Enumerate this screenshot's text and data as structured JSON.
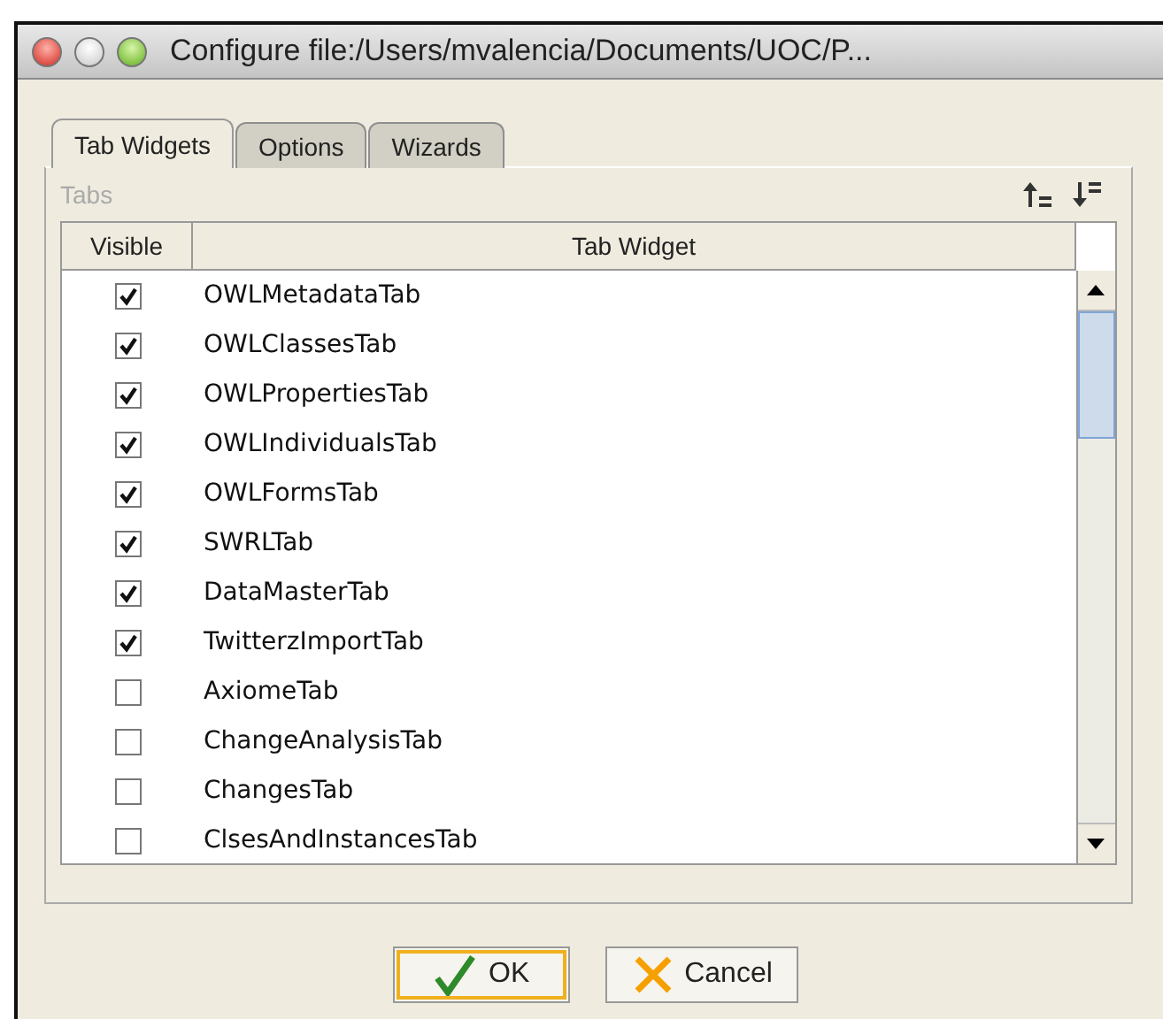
{
  "window": {
    "title": "Configure file:/Users/mvalencia/Documents/UOC/P..."
  },
  "tabs": [
    {
      "label": "Tab Widgets",
      "selected": true
    },
    {
      "label": "Options",
      "selected": false
    },
    {
      "label": "Wizards",
      "selected": false
    }
  ],
  "section": {
    "label": "Tabs"
  },
  "table": {
    "columns": [
      "Visible",
      "Tab Widget"
    ],
    "rows": [
      {
        "name": "OWLMetadataTab",
        "checked": true
      },
      {
        "name": "OWLClassesTab",
        "checked": true
      },
      {
        "name": "OWLPropertiesTab",
        "checked": true
      },
      {
        "name": "OWLIndividualsTab",
        "checked": true
      },
      {
        "name": "OWLFormsTab",
        "checked": true
      },
      {
        "name": "SWRLTab",
        "checked": true
      },
      {
        "name": "DataMasterTab",
        "checked": true
      },
      {
        "name": "TwitterzImportTab",
        "checked": true
      },
      {
        "name": "AxiomeTab",
        "checked": false
      },
      {
        "name": "ChangeAnalysisTab",
        "checked": false
      },
      {
        "name": "ChangesTab",
        "checked": false
      },
      {
        "name": "ClsesAndInstancesTab",
        "checked": false
      }
    ]
  },
  "buttons": [
    {
      "label": "OK",
      "kind": "ok"
    },
    {
      "label": "Cancel",
      "kind": "cancel"
    }
  ]
}
